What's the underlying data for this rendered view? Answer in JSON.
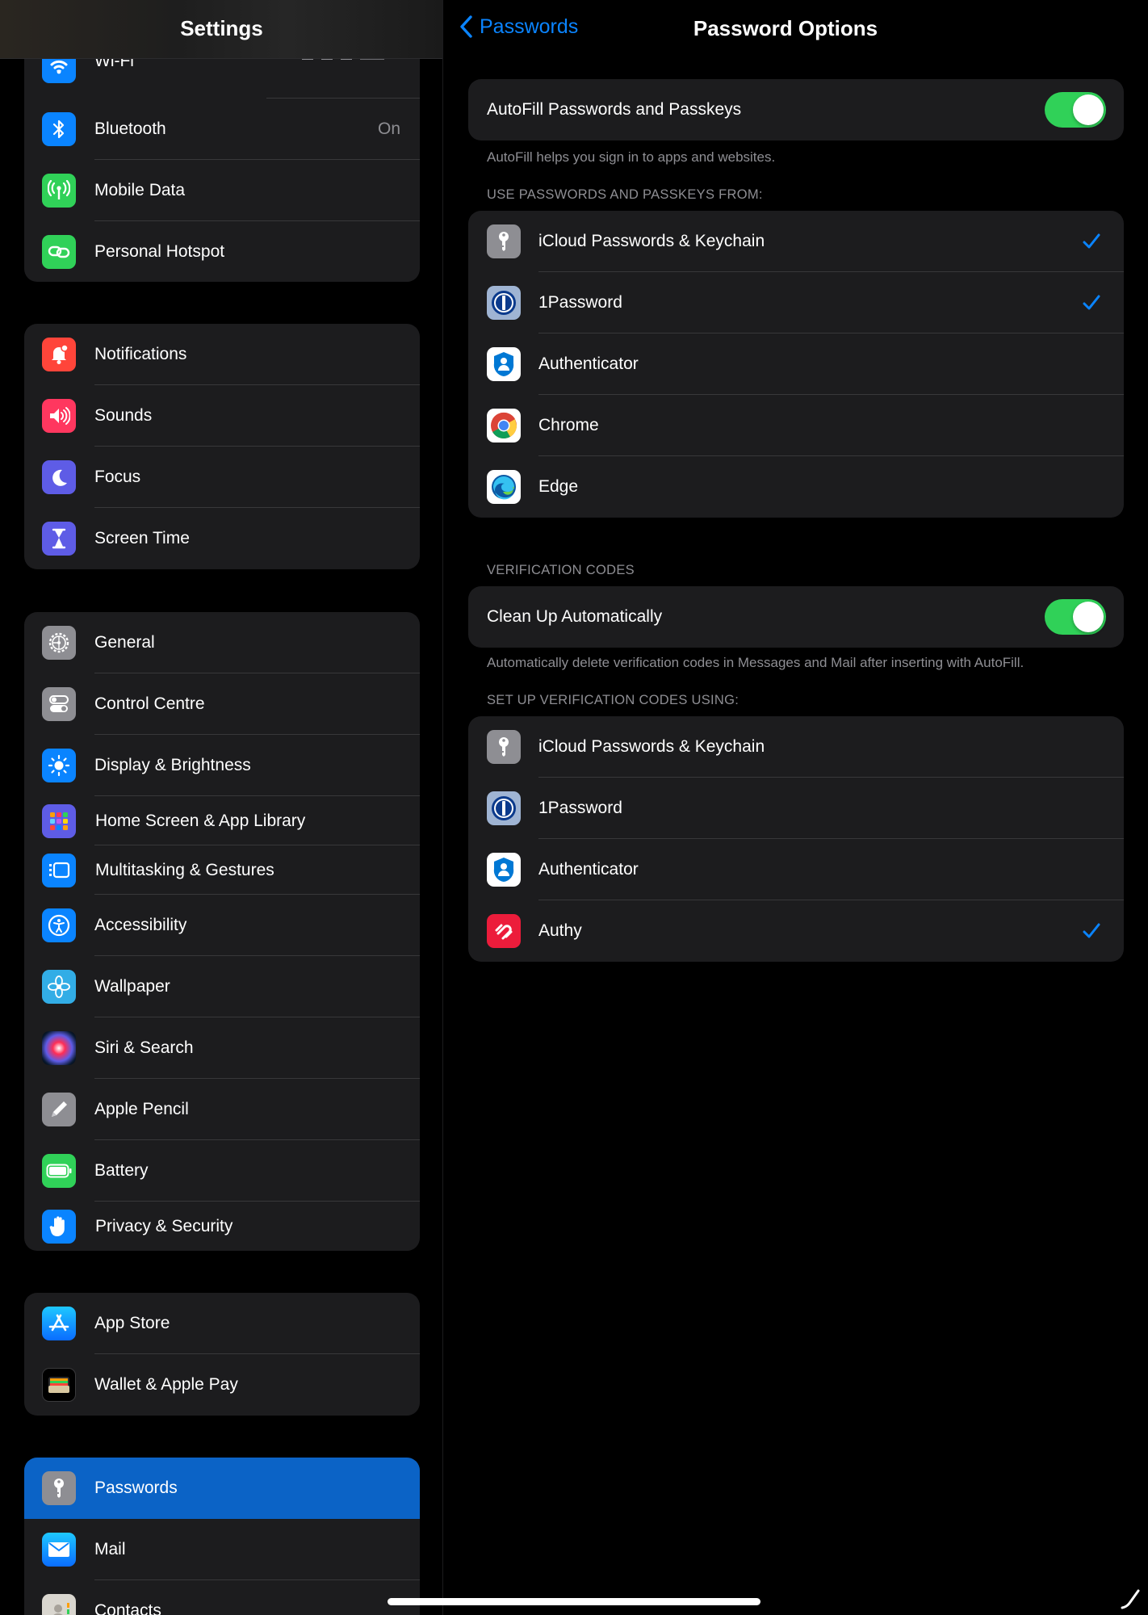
{
  "sidebar": {
    "title": "Settings",
    "groups": [
      {
        "items": [
          {
            "label": "Wi-Fi",
            "icon": "wifi-icon",
            "color": "#0a84ff"
          },
          {
            "label": "Bluetooth",
            "value": "On",
            "icon": "bluetooth-icon",
            "color": "#0a84ff"
          },
          {
            "label": "Mobile Data",
            "icon": "antenna-icon",
            "color": "#30d158"
          },
          {
            "label": "Personal Hotspot",
            "icon": "hotspot-link-icon",
            "color": "#30d158"
          }
        ]
      },
      {
        "items": [
          {
            "label": "Notifications",
            "icon": "bell-icon",
            "color": "#ff453a"
          },
          {
            "label": "Sounds",
            "icon": "speaker-icon",
            "color": "#ff375f"
          },
          {
            "label": "Focus",
            "icon": "moon-icon",
            "color": "#5e5ce6"
          },
          {
            "label": "Screen Time",
            "icon": "hourglass-icon",
            "color": "#5e5ce6"
          }
        ]
      },
      {
        "items": [
          {
            "label": "General",
            "icon": "gear-icon",
            "color": "#8e8e93"
          },
          {
            "label": "Control Centre",
            "icon": "switches-icon",
            "color": "#8e8e93"
          },
          {
            "label": "Display & Brightness",
            "icon": "sun-icon",
            "color": "#0a84ff"
          },
          {
            "label": "Home Screen & App Library",
            "icon": "app-grid-icon",
            "color": "#5e5ce6"
          },
          {
            "label": "Multitasking & Gestures",
            "icon": "multitasking-icon",
            "color": "#0a84ff"
          },
          {
            "label": "Accessibility",
            "icon": "accessibility-icon",
            "color": "#0a84ff"
          },
          {
            "label": "Wallpaper",
            "icon": "flower-icon",
            "color": "#32ade6"
          },
          {
            "label": "Siri & Search",
            "icon": "siri-icon",
            "color": "#1c1c1e"
          },
          {
            "label": "Apple Pencil",
            "icon": "pencil-icon",
            "color": "#8e8e93"
          },
          {
            "label": "Battery",
            "icon": "battery-icon",
            "color": "#30d158"
          },
          {
            "label": "Privacy & Security",
            "icon": "hand-icon",
            "color": "#0a84ff"
          }
        ]
      },
      {
        "items": [
          {
            "label": "App Store",
            "icon": "app-store-icon",
            "color": "#0a84ff"
          },
          {
            "label": "Wallet & Apple Pay",
            "icon": "wallet-icon",
            "color": "#1c1c1e"
          }
        ]
      },
      {
        "items": [
          {
            "label": "Passwords",
            "icon": "key-icon",
            "color": "#8e8e93",
            "selected": true
          },
          {
            "label": "Mail",
            "icon": "envelope-icon",
            "color": "#0a84ff"
          },
          {
            "label": "Contacts",
            "icon": "contacts-icon",
            "color": "#8e8e93"
          }
        ]
      }
    ]
  },
  "detail": {
    "back_label": "Passwords",
    "title": "Password Options",
    "autofill": {
      "label": "AutoFill Passwords and Passkeys",
      "enabled": true,
      "footnote": "AutoFill helps you sign in to apps and websites."
    },
    "passwords_section": {
      "header": "USE PASSWORDS AND PASSKEYS FROM:",
      "items": [
        {
          "label": "iCloud Passwords & Keychain",
          "icon": "keychain-icon",
          "checked": true
        },
        {
          "label": "1Password",
          "icon": "onepassword-icon",
          "checked": true
        },
        {
          "label": "Authenticator",
          "icon": "authenticator-icon",
          "checked": false
        },
        {
          "label": "Chrome",
          "icon": "chrome-icon",
          "checked": false
        },
        {
          "label": "Edge",
          "icon": "edge-icon",
          "checked": false
        }
      ]
    },
    "verification": {
      "header": "VERIFICATION CODES",
      "cleanup_label": "Clean Up Automatically",
      "cleanup_enabled": true,
      "footnote": "Automatically delete verification codes in Messages and Mail after inserting with AutoFill."
    },
    "setup_section": {
      "header": "SET UP VERIFICATION CODES USING:",
      "items": [
        {
          "label": "iCloud Passwords & Keychain",
          "icon": "keychain-icon",
          "checked": false
        },
        {
          "label": "1Password",
          "icon": "onepassword-icon",
          "checked": false
        },
        {
          "label": "Authenticator",
          "icon": "authenticator-icon",
          "checked": false
        },
        {
          "label": "Authy",
          "icon": "authy-icon",
          "checked": true
        }
      ]
    }
  }
}
